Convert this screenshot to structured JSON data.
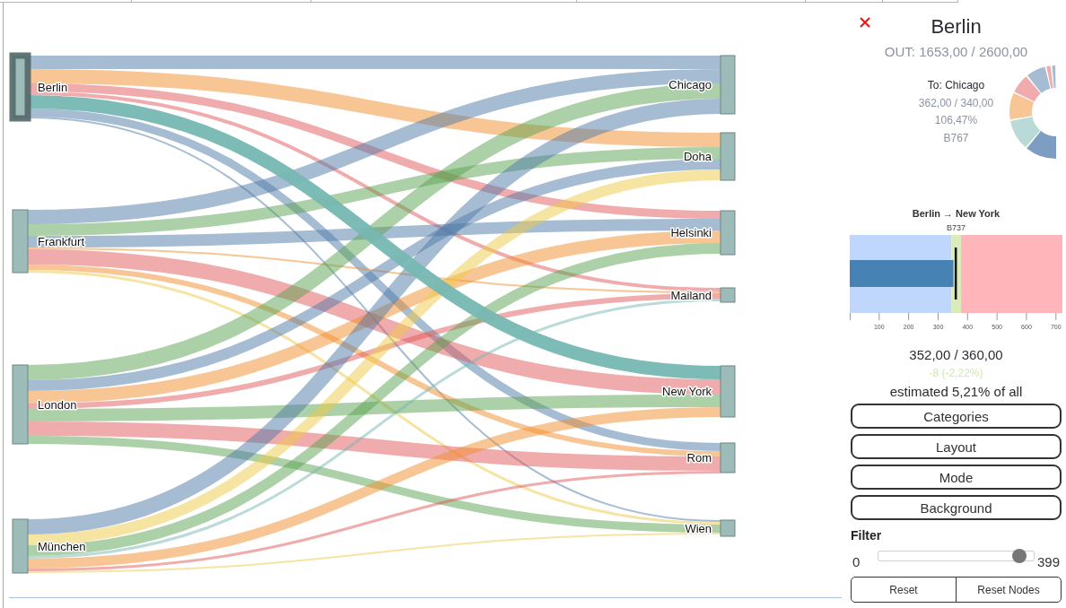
{
  "sankey": {
    "source_nodes": [
      {
        "name": "Berlin",
        "selected": true
      },
      {
        "name": "Frankfurt",
        "selected": false
      },
      {
        "name": "London",
        "selected": false
      },
      {
        "name": "München",
        "selected": false
      }
    ],
    "target_nodes": [
      {
        "name": "Chicago",
        "selected": false
      },
      {
        "name": "Doha",
        "selected": false
      },
      {
        "name": "Helsinki",
        "selected": false
      },
      {
        "name": "Mailand",
        "selected": false
      },
      {
        "name": "New York",
        "selected": false
      },
      {
        "name": "Rom",
        "selected": false
      },
      {
        "name": "Wien",
        "selected": false
      }
    ]
  },
  "details": {
    "title": "Berlin",
    "summary": "OUT: 1653,00 / 2600,00",
    "hover_info": {
      "destination": "To: Chicago",
      "values": "362,00 / 340,00",
      "percent": "106,47%",
      "aircraft": "B767"
    },
    "link_detail": {
      "chart_data": {
        "type": "bar",
        "orientation": "horizontal",
        "title": "Berlin → New York",
        "series": [
          {
            "name": "B737",
            "color": "#4682b4",
            "values": [
              352
            ]
          }
        ],
        "xlim": [
          0,
          722
        ],
        "xticks": [
          100,
          200,
          300,
          400,
          500,
          600,
          700
        ],
        "bands": [
          {
            "axis": "x",
            "from": 0,
            "to": 345,
            "color": "#bfd7fd"
          },
          {
            "axis": "x",
            "from": 345,
            "to": 378,
            "color": "#d9ecba"
          },
          {
            "axis": "x",
            "from": 378,
            "to": 722,
            "color": "#ffb5b9"
          }
        ],
        "ref_lines": [
          {
            "axis": "x",
            "value": 360
          }
        ]
      },
      "values": "352,00 / 360,00",
      "difference": "-8 (-2,22%)",
      "share": "estimated 5,21% of all"
    }
  },
  "menu_buttons": [
    "Categories",
    "Layout",
    "Mode",
    "Background"
  ],
  "filter": {
    "label": "Filter",
    "min": "0",
    "max": "399",
    "level": 0.95
  },
  "action_buttons": [
    "Reset",
    "Reset Nodes"
  ]
}
